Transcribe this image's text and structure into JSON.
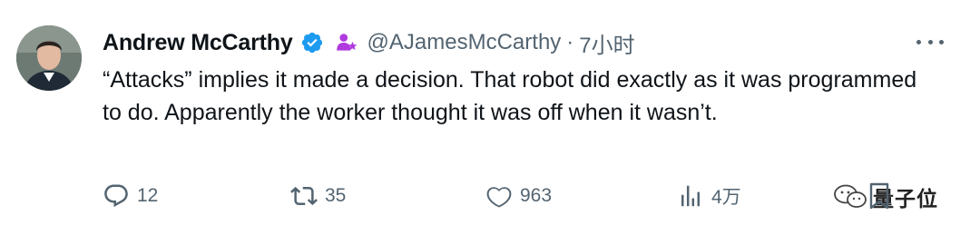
{
  "tweet": {
    "author_name": "Andrew McCarthy",
    "handle": "@AJamesMcCarthy",
    "separator": "·",
    "timestamp": "7小时",
    "text": "“Attacks” implies it made a decision. That robot did exactly as it was programmed to do. Apparently the worker thought it was off when it wasn’t."
  },
  "actions": {
    "replies": "12",
    "retweets": "35",
    "likes": "963",
    "views": "4万"
  },
  "watermark": {
    "text": "量子位"
  },
  "icons": {
    "verified": "verified-badge-icon",
    "affiliation": "affiliation-badge-icon",
    "more": "more-options-icon",
    "reply": "reply-icon",
    "retweet": "retweet-icon",
    "like": "heart-icon",
    "views": "views-icon",
    "bookmark": "bookmark-icon"
  },
  "colors": {
    "text_primary": "#0f1419",
    "text_secondary": "#536471",
    "verified_blue": "#1d9bf0",
    "affiliation_purple": "#b03adf"
  }
}
